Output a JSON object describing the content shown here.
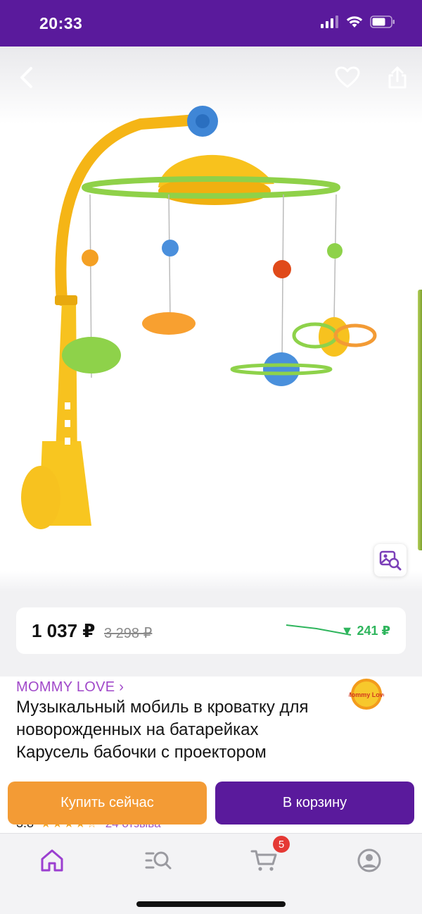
{
  "status_bar": {
    "time": "20:33"
  },
  "product": {
    "price_current": "1 037 ₽",
    "price_old": "3 298 ₽",
    "price_drop": "▼ 241 ₽",
    "brand": "MOMMY LOVE ›",
    "brand_logo_text": "Mommy Love",
    "title": "Музыкальный мобиль в кроватку для новорожденных на батарейках Карусель бабочки с проектором",
    "rating": "3.8",
    "stars": "★★★★☆",
    "reviews": "24 отзыва"
  },
  "actions": {
    "buy_now": "Купить сейчас",
    "add_to_cart": "В корзину"
  },
  "tabbar": {
    "cart_badge": "5"
  },
  "colors": {
    "brand_purple": "#5a1a9c",
    "buy_orange": "#f39b35",
    "price_drop_green": "#2fb55d",
    "brand_link": "#a048c9"
  }
}
